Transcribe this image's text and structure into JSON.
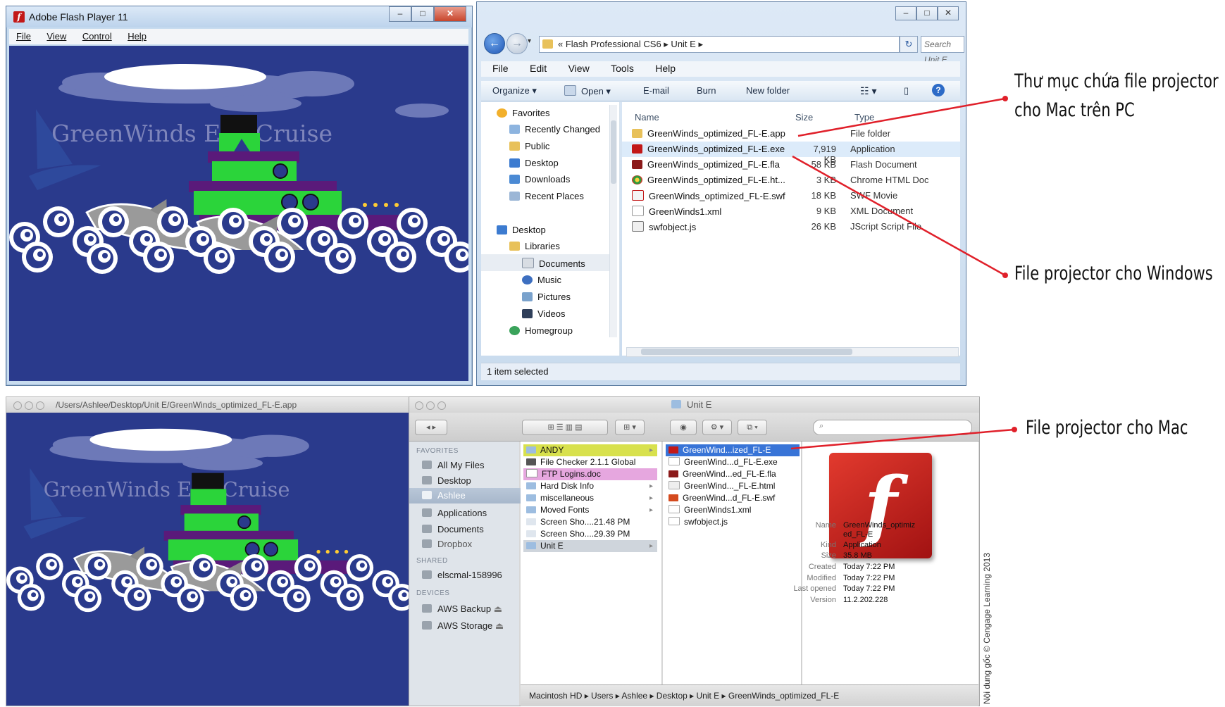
{
  "win_flash_player": {
    "title": "Adobe Flash Player 11",
    "menu": [
      "File",
      "View",
      "Control",
      "Help"
    ],
    "stage_text": "GreenWinds Eco-Cruise"
  },
  "explorer": {
    "address": "« Flash Professional CS6 ▸ Unit E ▸",
    "search_placeholder": "Search Unit E",
    "menu": [
      "File",
      "Edit",
      "View",
      "Tools",
      "Help"
    ],
    "toolbar": {
      "organize": "Organize ▾",
      "open": "Open ▾",
      "email": "E-mail",
      "burn": "Burn",
      "new_folder": "New folder"
    },
    "nav": {
      "favorites": "Favorites",
      "recently_changed": "Recently Changed",
      "public": "Public",
      "desktop": "Desktop",
      "downloads": "Downloads",
      "recent_places": "Recent Places",
      "desktop2": "Desktop",
      "libraries": "Libraries",
      "documents": "Documents",
      "music": "Music",
      "pictures": "Pictures",
      "videos": "Videos",
      "homegroup": "Homegroup"
    },
    "columns": {
      "name": "Name",
      "size": "Size",
      "type": "Type"
    },
    "files": [
      {
        "name": "GreenWinds_optimized_FL-E.app",
        "size": "",
        "type": "File folder"
      },
      {
        "name": "GreenWinds_optimized_FL-E.exe",
        "size": "7,919 KB",
        "type": "Application"
      },
      {
        "name": "GreenWinds_optimized_FL-E.fla",
        "size": "58 KB",
        "type": "Flash Document"
      },
      {
        "name": "GreenWinds_optimized_FL-E.ht...",
        "size": "3 KB",
        "type": "Chrome HTML Doc"
      },
      {
        "name": "GreenWinds_optimized_FL-E.swf",
        "size": "18 KB",
        "type": "SWF Movie"
      },
      {
        "name": "GreenWinds1.xml",
        "size": "9 KB",
        "type": "XML Document"
      },
      {
        "name": "swfobject.js",
        "size": "26 KB",
        "type": "JScript Script File"
      }
    ],
    "status": "1 item selected"
  },
  "mac_flash_player": {
    "title": "/Users/Ashlee/Desktop/Unit E/GreenWinds_optimized_FL-E.app",
    "stage_text": "GreenWinds Eco-Cruise"
  },
  "finder": {
    "title": "Unit E",
    "sidebar": {
      "favorites_header": "FAVORITES",
      "all_my_files": "All My Files",
      "desktop": "Desktop",
      "ashlee": "Ashlee",
      "applications": "Applications",
      "documents": "Documents",
      "dropbox": "Dropbox",
      "shared_header": "SHARED",
      "elscmal": "elscmal-158996",
      "devices_header": "DEVICES",
      "aws_backup": "AWS Backup",
      "aws_storage": "AWS Storage"
    },
    "col1": [
      {
        "label": "ANDY",
        "arrow": "▸"
      },
      {
        "label": "File Checker 2.1.1 Global",
        "arrow": ""
      },
      {
        "label": "FTP Logins.doc",
        "arrow": ""
      },
      {
        "label": "Hard Disk Info",
        "arrow": "▸"
      },
      {
        "label": "miscellaneous",
        "arrow": "▸"
      },
      {
        "label": "Moved Fonts",
        "arrow": "▸"
      },
      {
        "label": "Screen Sho....21.48 PM",
        "arrow": ""
      },
      {
        "label": "Screen Sho....29.39 PM",
        "arrow": ""
      },
      {
        "label": "Unit E",
        "arrow": "▸"
      }
    ],
    "col2": [
      "GreenWind...ized_FL-E",
      "GreenWind...d_FL-E.exe",
      "GreenWind...ed_FL-E.fla",
      "GreenWind..._FL-E.html",
      "GreenWind...d_FL-E.swf",
      "GreenWinds1.xml",
      "swfobject.js"
    ],
    "preview_glyph": "f",
    "meta": {
      "name_label": "Name",
      "name_value1": "GreenWinds_optimiz",
      "name_value2": "ed_FL-E",
      "kind_label": "Kind",
      "kind_value": "Application",
      "size_label": "Size",
      "size_value": "35.8 MB",
      "created_label": "Created",
      "created_value": "Today 7:22 PM",
      "modified_label": "Modified",
      "modified_value": "Today 7:22 PM",
      "opened_label": "Last opened",
      "opened_value": "Today 7:22 PM",
      "version_label": "Version",
      "version_value": "11.2.202.228"
    },
    "path": "Macintosh HD ▸ Users ▸ Ashlee ▸ Desktop ▸ Unit E ▸ GreenWinds_optimized_FL-E"
  },
  "callouts": {
    "mac_on_pc_line1": "Thư mục chứa file projector",
    "mac_on_pc_line2": "cho Mac trên PC",
    "windows": "File projector cho Windows",
    "mac": "File projector cho Mac"
  },
  "credit": "Nội dung gốc © Cengage Learning 2013",
  "colors": {
    "callout_red": "#e0202a",
    "stage_blue": "#2a3a8c",
    "flash_red": "#c21818"
  }
}
